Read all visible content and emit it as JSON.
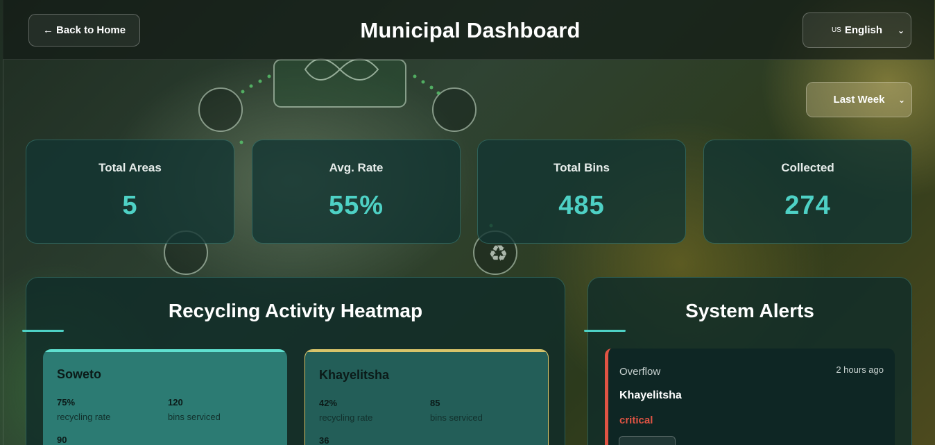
{
  "header": {
    "back_label": "← Back to Home",
    "title": "Municipal Dashboard",
    "language": {
      "flag": "US",
      "selected": "English"
    }
  },
  "filters": {
    "time_range": "Last Week"
  },
  "stats": [
    {
      "label": "Total Areas",
      "value": "5"
    },
    {
      "label": "Avg. Rate",
      "value": "55%"
    },
    {
      "label": "Total Bins",
      "value": "485"
    },
    {
      "label": "Collected",
      "value": "274"
    }
  ],
  "heatmap": {
    "title": "Recycling Activity Heatmap",
    "areas": [
      {
        "name": "Soweto",
        "rate": "75%",
        "rate_label": "recycling rate",
        "bins": "120",
        "bins_label": "bins serviced",
        "third_value": "90",
        "accent": "#5fe0cf"
      },
      {
        "name": "Khayelitsha",
        "rate": "42%",
        "rate_label": "recycling rate",
        "bins": "85",
        "bins_label": "bins serviced",
        "third_value": "36",
        "accent": "#d8c46a"
      }
    ]
  },
  "alerts": {
    "title": "System Alerts",
    "items": [
      {
        "type": "Overflow",
        "time": "2 hours ago",
        "area": "Khayelitsha",
        "severity": "critical",
        "severity_color": "#e05444"
      }
    ]
  },
  "colors": {
    "accent": "#4ed1c5",
    "critical": "#e05444"
  }
}
